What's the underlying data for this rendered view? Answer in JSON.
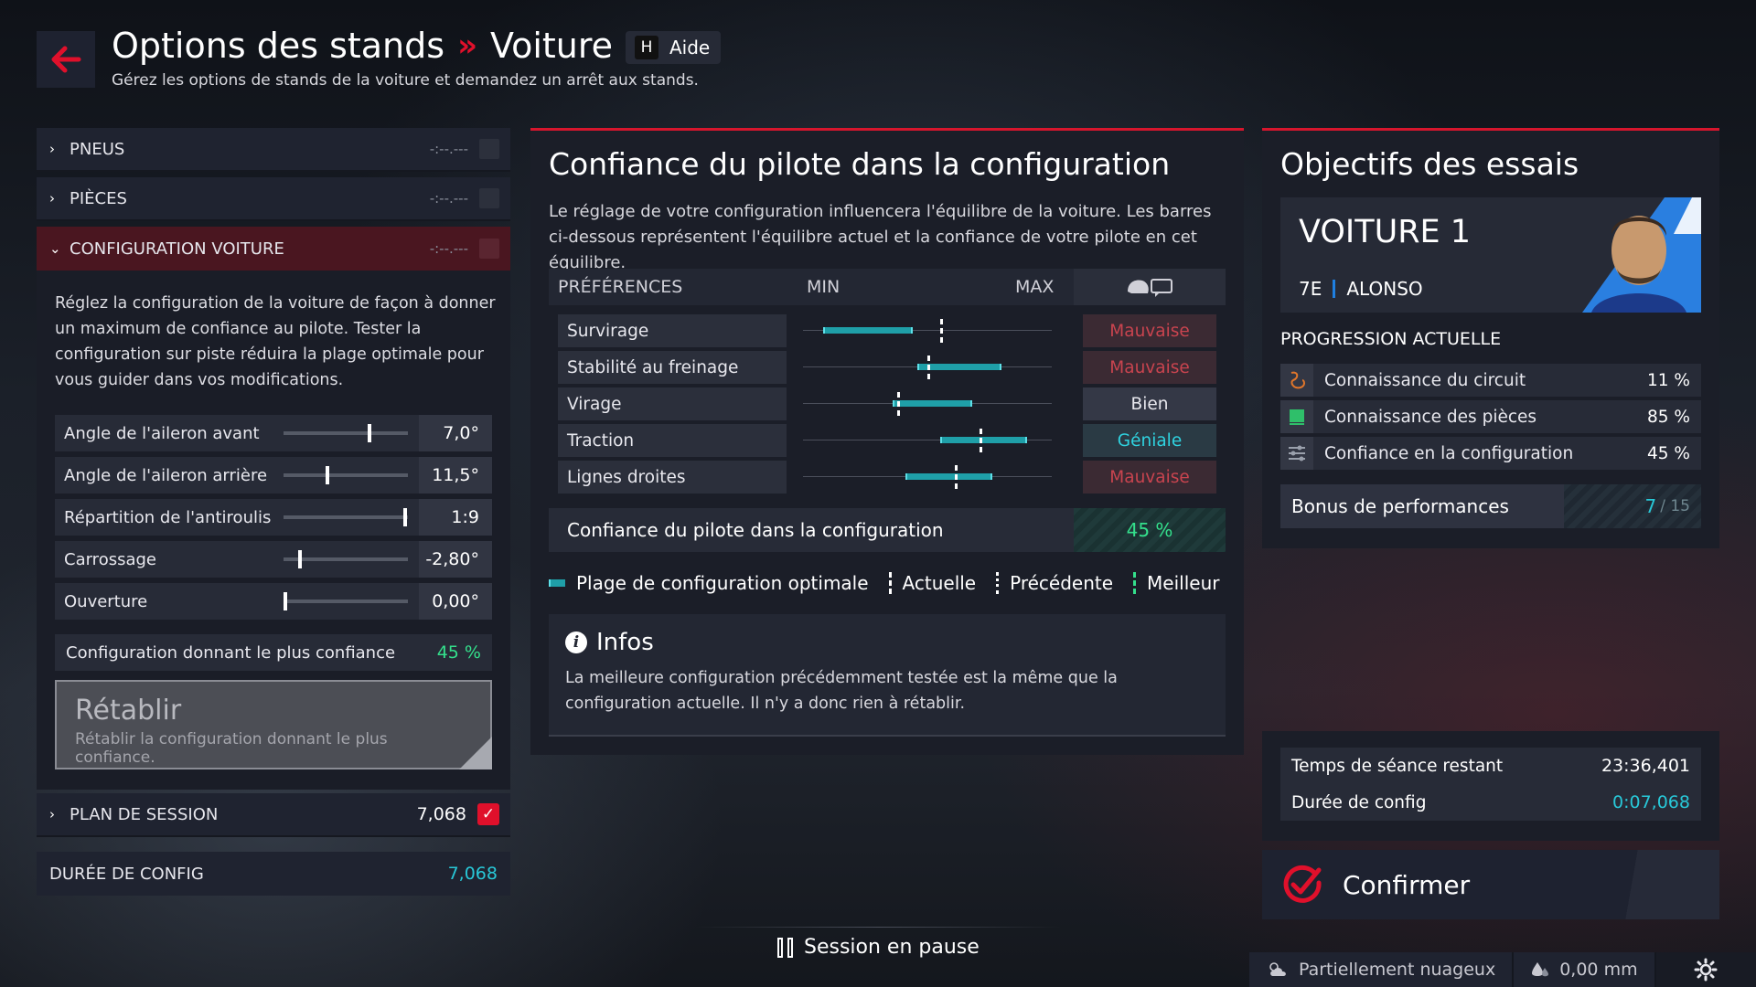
{
  "header": {
    "title": "Options des stands",
    "separator": "»",
    "subtitle_car": "Voiture 1",
    "help_key": "H",
    "help_label": "Aide",
    "description": "Gérez les options de stands de la voiture et demandez un arrêt aux stands."
  },
  "left": {
    "tires": {
      "label": "PNEUS",
      "time": "-:--.---"
    },
    "parts": {
      "label": "PIÈCES",
      "time": "-:--.---"
    },
    "config": {
      "label": "CONFIGURATION VOITURE",
      "time": "-:--.---"
    },
    "config_desc": "Réglez la configuration de la voiture de façon à donner un maximum de confiance au pilote. Tester la configuration sur piste réduira la plage optimale pour vous guider dans vos modifications.",
    "sliders": [
      {
        "label": "Angle de l'aileron avant",
        "value": "7,0°",
        "pos": 0.7
      },
      {
        "label": "Angle de l'aileron arrière",
        "value": "11,5°",
        "pos": 0.35
      },
      {
        "label": "Répartition de l'antiroulis",
        "value": "1:9",
        "pos": 0.99
      },
      {
        "label": "Carrossage",
        "value": "-2,80°",
        "pos": 0.12
      },
      {
        "label": "Ouverture",
        "value": "0,00°",
        "pos": 0.0
      }
    ],
    "best_config_label": "Configuration donnant le plus confiance",
    "best_config_value": "45 %",
    "reset_title": "Rétablir",
    "reset_desc": "Rétablir la configuration donnant le plus confiance.",
    "session_plan_label": "PLAN DE SESSION",
    "session_plan_value": "7,068",
    "config_duration_label": "DURÉE DE CONFIG",
    "config_duration_value": "7,068"
  },
  "center": {
    "title": "Confiance du pilote dans la configuration",
    "description": "Le réglage de votre configuration influencera l'équilibre de la voiture. Les barres ci-dessous représentent l'équilibre actuel et la confiance de votre pilote en cet équilibre.",
    "col_preferences": "PRÉFÉRENCES",
    "col_min": "MIN",
    "col_max": "MAX",
    "rows": [
      {
        "label": "Survirage",
        "range": [
          0.08,
          0.44
        ],
        "current": 0.55,
        "rating": "Mauvaise",
        "rating_class": "bad"
      },
      {
        "label": "Stabilité au freinage",
        "range": [
          0.46,
          0.8
        ],
        "current": 0.5,
        "rating": "Mauvaise",
        "rating_class": "bad"
      },
      {
        "label": "Virage",
        "range": [
          0.36,
          0.68
        ],
        "current": 0.38,
        "rating": "Bien",
        "rating_class": "ok"
      },
      {
        "label": "Traction",
        "range": [
          0.55,
          0.9
        ],
        "current": 0.71,
        "rating": "Géniale",
        "rating_class": "great"
      },
      {
        "label": "Lignes droites",
        "range": [
          0.41,
          0.76
        ],
        "current": 0.61,
        "rating": "Mauvaise",
        "rating_class": "bad"
      }
    ],
    "confidence_label": "Confiance du pilote dans la configuration",
    "confidence_value": "45 %",
    "legend": {
      "optimal": "Plage de configuration optimale",
      "current": "Actuelle",
      "previous": "Précédente",
      "best": "Meilleur"
    },
    "info_title": "Infos",
    "info_text": "La meilleure configuration précédemment testée est la même que la configuration actuelle. Il n'y a donc rien à rétablir."
  },
  "right": {
    "title": "Objectifs des essais",
    "car": "VOITURE 1",
    "position": "7E",
    "driver": "ALONSO",
    "progress_title": "PROGRESSION ACTUELLE",
    "progress": [
      {
        "label": "Connaissance du circuit",
        "value": "11 %",
        "icon": "circuit-icon"
      },
      {
        "label": "Connaissance des pièces",
        "value": "85 %",
        "icon": "parts-icon"
      },
      {
        "label": "Confiance en la configuration",
        "value": "45 %",
        "icon": "setup-sliders-icon"
      }
    ],
    "bonus_label": "Bonus de performances",
    "bonus_value": "7",
    "bonus_total": "/ 15",
    "session_time_label": "Temps de séance restant",
    "session_time_value": "23:36,401",
    "config_duration_label": "Durée de config",
    "config_duration_value": "0:07,068",
    "confirm_label": "Confirmer"
  },
  "footer": {
    "pause_label": "Session en pause",
    "weather": "Partiellement nuageux",
    "rain": "0,00 mm"
  },
  "colors": {
    "accent_red": "#e0102b",
    "teal": "#28c8d8",
    "green": "#34e08c",
    "bad": "#c9444f"
  }
}
